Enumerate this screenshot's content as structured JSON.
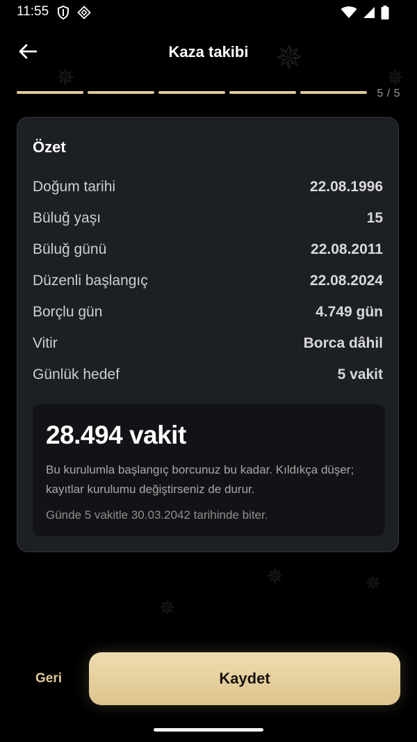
{
  "status_bar": {
    "time": "11:55",
    "icons": [
      "shield-icon",
      "app-badge-icon",
      "wifi-icon",
      "signal-icon",
      "battery-icon"
    ]
  },
  "app_bar": {
    "title": "Kaza takibi",
    "back_icon": "arrow-left-icon"
  },
  "progress": {
    "current": 5,
    "total": 5,
    "label": "5 / 5"
  },
  "summary": {
    "title": "Özet",
    "rows": [
      {
        "label": "Doğum tarihi",
        "value": "22.08.1996"
      },
      {
        "label": "Büluğ yaşı",
        "value": "15"
      },
      {
        "label": "Büluğ günü",
        "value": "22.08.2011"
      },
      {
        "label": "Düzenli başlangıç",
        "value": "22.08.2024"
      },
      {
        "label": "Borçlu gün",
        "value": "4.749 gün"
      },
      {
        "label": "Vitir",
        "value": "Borca dâhil"
      },
      {
        "label": "Günlük hedef",
        "value": "5 vakit"
      }
    ],
    "total": {
      "value": "28.494 vakit",
      "description": "Bu kurulumla başlangıç borcunuz bu kadar. Kıldıkça düşer; kayıtlar kurulumu değiştirseniz de durur.",
      "finish": "Günde 5 vakitle 30.03.2042 tarihinde biter."
    }
  },
  "actions": {
    "back_label": "Geri",
    "save_label": "Kaydet"
  },
  "colors": {
    "accent": "#e0c89a",
    "background": "#000000",
    "card": "#1c1f24",
    "inner_card": "#121316"
  }
}
